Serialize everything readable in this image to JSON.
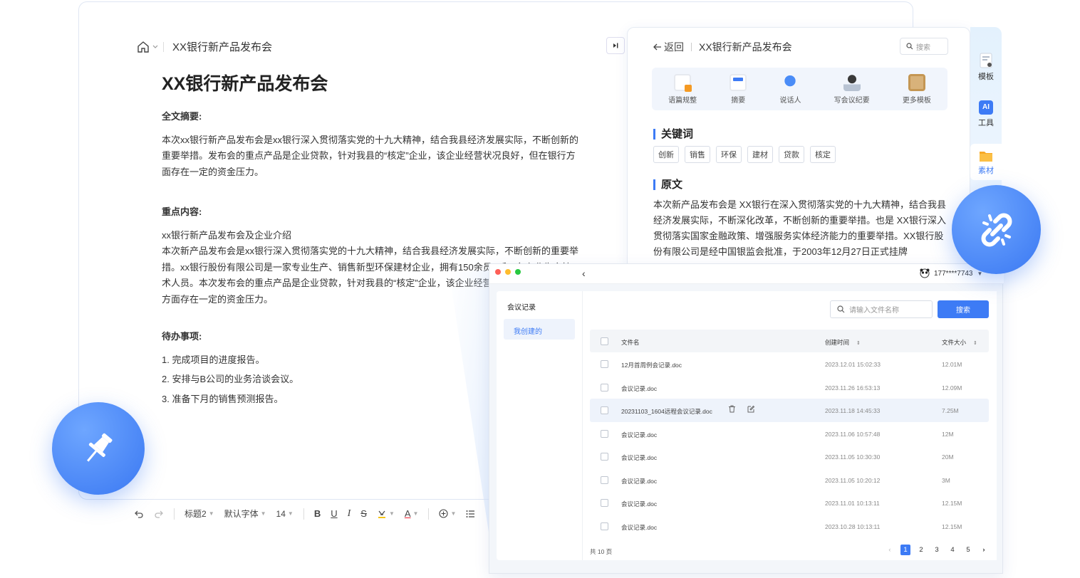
{
  "editor": {
    "breadcrumb": "XX银行新产品发布会",
    "title": "XX银行新产品发布会",
    "summary_heading": "全文摘要:",
    "summary_text": "本次xx银行新产品发布会是xx银行深入贯彻落实党的十九大精神，结合我县经济发展实际，不断创新的重要举措。发布会的重点产品是企业贷款，针对我县的“核定”企业，该企业经营状况良好，但在银行方面存在一定的资金压力。",
    "key_heading": "重点内容:",
    "key_line1": "xx银行新产品发布会及企业介绍",
    "key_text": "本次新产品发布会是xx银行深入贯彻落实党的十九大精神，结合我县经济发展实际，不断创新的重要举措。xx银行股份有限公司是一家专业生产、销售新型环保建材企业，拥有150余员工和5名专业生产技术人员。本次发布会的重点产品是企业贷款，针对我县的“核定”企业，该企业经营状况良好，但在银行方面存在一定的资金压力。",
    "todo_heading": "待办事项:",
    "todos": [
      "1. 完成项目的进度报告。",
      "2. 安排与B公司的业务洽谈会议。",
      "3. 准备下月的销售预测报告。"
    ],
    "toolbar": {
      "heading": "标题2",
      "font": "默认字体",
      "size": "14",
      "bold": "B",
      "underline": "U",
      "italic": "I",
      "strike": "S",
      "color": "A"
    }
  },
  "summary_panel": {
    "back": "返回",
    "title": "XX银行新产品发布会",
    "search_placeholder": "搜索",
    "tools": [
      "语篇规整",
      "摘要",
      "说话人",
      "写会议纪要",
      "更多模板"
    ],
    "keywords_heading": "关键词",
    "keywords": [
      "创新",
      "销售",
      "环保",
      "建材",
      "贷款",
      "核定"
    ],
    "original_heading": "原文",
    "original_text": "本次新产品发布会是  XX银行在深入贯彻落实党的十九大精神，结合我县经济发展实际，不断深化改革，不断创新的重要举措。也是  XX银行深入贯彻落实国家金融政策、增强服务实体经济能力的重要举措。XX银行股份有限公司是经中国银监会批准，于2003年12月27日正式挂牌"
  },
  "rail": {
    "template": "模板",
    "ai": "AI",
    "tools": "工具",
    "material": "素材"
  },
  "file_manager": {
    "user": "177****7743",
    "nav_label": "会议记录",
    "nav_mine": "我创建的",
    "search_placeholder": "请输入文件名称",
    "search_button": "搜索",
    "columns": {
      "name": "文件名",
      "time": "创建时间",
      "size": "文件大小"
    },
    "rows": [
      {
        "name": "12月首周例会记录.doc",
        "time": "2023.12.01  15:02:33",
        "size": "12.01M"
      },
      {
        "name": "会议记录.doc",
        "time": "2023.11.26  16:53:13",
        "size": "12.09M"
      },
      {
        "name": "20231103_1604远程会议记录.doc",
        "time": "2023.11.18  14:45:33",
        "size": "7.25M"
      },
      {
        "name": "会议记录.doc",
        "time": "2023.11.06  10:57:48",
        "size": "12M"
      },
      {
        "name": "会议记录.doc",
        "time": "2023.11.05  10:30:30",
        "size": "20M"
      },
      {
        "name": "会议记录.doc",
        "time": "2023.11.05  10:20:12",
        "size": "3M"
      },
      {
        "name": "会议记录.doc",
        "time": "2023.11.01  10:13:11",
        "size": "12.15M"
      },
      {
        "name": "会议记录.doc",
        "time": "2023.10.28  10:13:11",
        "size": "12.15M"
      }
    ],
    "total": "共 10 页",
    "pages": [
      "1",
      "2",
      "3",
      "4",
      "5"
    ],
    "accent": "#3d7bf5"
  }
}
